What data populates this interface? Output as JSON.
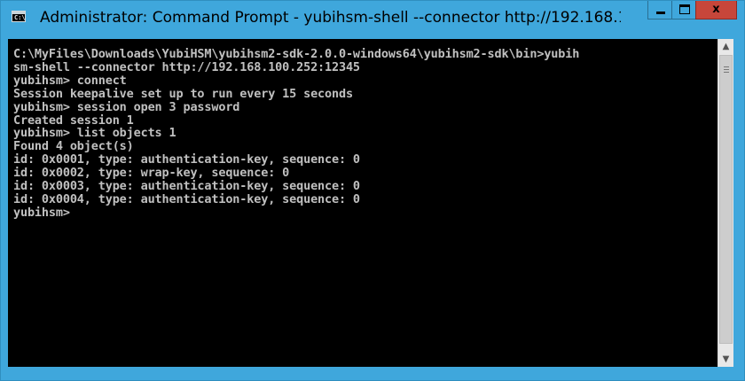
{
  "window": {
    "title": "Administrator: Command Prompt - yubihsm-shell  --connector http://192.168.1...",
    "icon_text": "C:\\",
    "icon": "command-prompt-icon",
    "caption_buttons": {
      "minimize_icon": "minimize-icon",
      "maximize_icon": "maximize-icon",
      "close_glyph": "x"
    },
    "accent_color": "#3fa7dc",
    "close_color": "#c7463a"
  },
  "console": {
    "lines": [
      "C:\\MyFiles\\Downloads\\YubiHSM\\yubihsm2-sdk-2.0.0-windows64\\yubihsm2-sdk\\bin>yubih",
      "sm-shell --connector http://192.168.100.252:12345",
      "yubihsm> connect",
      "Session keepalive set up to run every 15 seconds",
      "yubihsm> session open 3 password",
      "Created session 1",
      "yubihsm> list objects 1",
      "Found 4 object(s)",
      "id: 0x0001, type: authentication-key, sequence: 0",
      "id: 0x0002, type: wrap-key, sequence: 0",
      "id: 0x0003, type: authentication-key, sequence: 0",
      "id: 0x0004, type: authentication-key, sequence: 0",
      "yubihsm>"
    ],
    "background_color": "#000000",
    "text_color": "#c0c0c0"
  },
  "scrollbar": {
    "up_arrow": "▲",
    "down_arrow": "▼"
  }
}
